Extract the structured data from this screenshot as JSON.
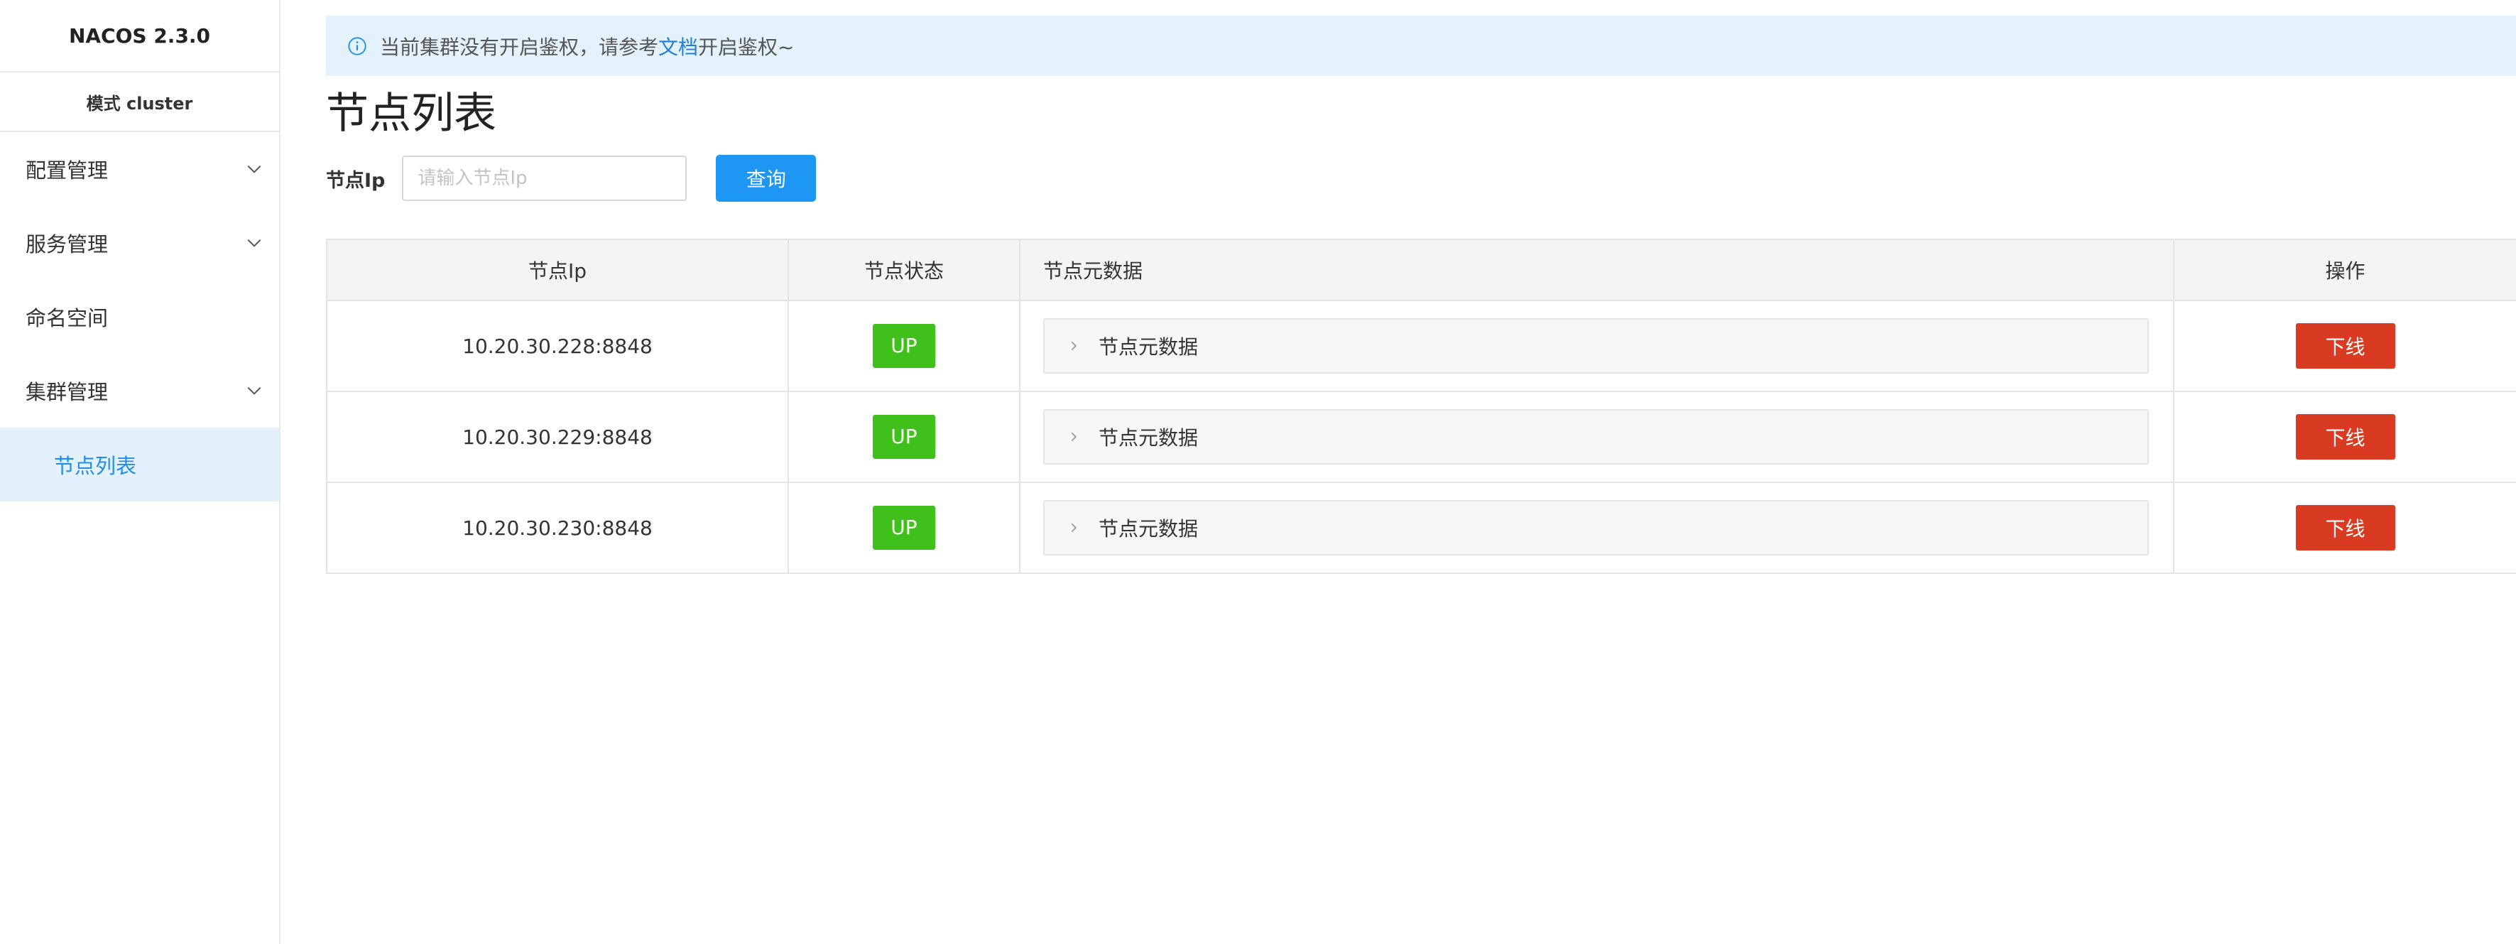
{
  "sidebar": {
    "brand": "NACOS 2.3.0",
    "mode": "模式 cluster",
    "items": [
      {
        "label": "配置管理",
        "expandable": true
      },
      {
        "label": "服务管理",
        "expandable": true
      },
      {
        "label": "命名空间",
        "expandable": false
      },
      {
        "label": "集群管理",
        "expandable": true,
        "expanded": true
      },
      {
        "label": "节点列表",
        "sub": true,
        "active": true
      }
    ]
  },
  "notice": {
    "prefix": "当前集群没有开启鉴权，请参考",
    "link": "文档",
    "suffix": "开启鉴权~",
    "icon": "info-icon"
  },
  "page": {
    "title": "节点列表"
  },
  "search": {
    "label": "节点Ip",
    "placeholder": "请输入节点Ip",
    "value": "",
    "button": "查询"
  },
  "table": {
    "headers": [
      "节点Ip",
      "节点状态",
      "节点元数据",
      "操作"
    ],
    "rows": [
      {
        "ip": "10.20.30.228:8848",
        "status": "UP",
        "metadata": "节点元数据",
        "action": "下线"
      },
      {
        "ip": "10.20.30.229:8848",
        "status": "UP",
        "metadata": "节点元数据",
        "action": "下线"
      },
      {
        "ip": "10.20.30.230:8848",
        "status": "UP",
        "metadata": "节点元数据",
        "action": "下线"
      }
    ]
  },
  "colors": {
    "primary": "#1e96f3",
    "success": "#40c01b",
    "danger": "#d83a22",
    "active_bg": "#e4f1fc"
  }
}
